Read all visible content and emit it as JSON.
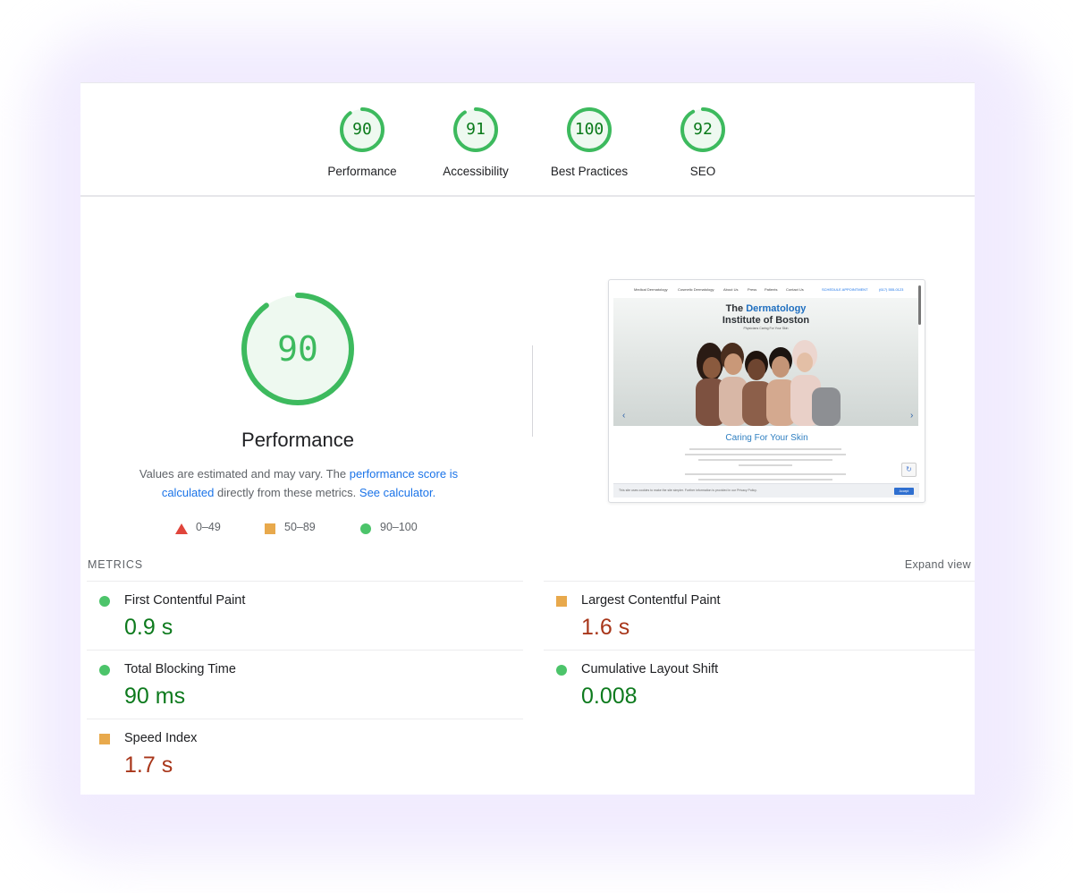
{
  "colors": {
    "pass": "#0d7a1d",
    "pass_ring": "#3dba5e",
    "average": "#a8361a",
    "average_icon": "#e8a94c",
    "fail_icon": "#e0453b",
    "link": "#1a73e8"
  },
  "category_gauges": [
    {
      "score": "90",
      "label": "Performance"
    },
    {
      "score": "91",
      "label": "Accessibility"
    },
    {
      "score": "100",
      "label": "Best Practices"
    },
    {
      "score": "92",
      "label": "SEO"
    }
  ],
  "performance": {
    "score": "90",
    "title": "Performance",
    "desc_prefix": "Values are estimated and may vary. The ",
    "desc_link1": "performance score is calculated",
    "desc_middle": " directly from these metrics. ",
    "desc_link2": "See calculator.",
    "legend": [
      {
        "icon": "triangle-icon",
        "range": "0–49"
      },
      {
        "icon": "square-icon",
        "range": "50–89"
      },
      {
        "icon": "circle-icon",
        "range": "90–100"
      }
    ]
  },
  "screenshot": {
    "nav": [
      "Medical Dermatology",
      "Cosmetic Dermatology",
      "About Us",
      "Press",
      "Patients",
      "Contact Us"
    ],
    "nav_cta": [
      "SCHEDULE APPOINTMENT",
      "(617) 555-0123"
    ],
    "hero_title_prefix": "The ",
    "hero_title_highlight": "Dermatology",
    "hero_title_line2": "Institute of Boston",
    "hero_tagline": "Physicians Caring For Your Skin",
    "section_heading": "Caring For Your Skin",
    "cookie_text": "This site uses cookies to make the site simpler. Further information is provided in our Privacy Policy.",
    "cookie_button": "Accept"
  },
  "metrics": {
    "header": "METRICS",
    "expand": "Expand view",
    "items": [
      {
        "label": "First Contentful Paint",
        "value": "0.9 s",
        "status": "pass",
        "icon": "circle-icon"
      },
      {
        "label": "Largest Contentful Paint",
        "value": "1.6 s",
        "status": "average",
        "icon": "square-icon"
      },
      {
        "label": "Total Blocking Time",
        "value": "90 ms",
        "status": "pass",
        "icon": "circle-icon"
      },
      {
        "label": "Cumulative Layout Shift",
        "value": "0.008",
        "status": "pass",
        "icon": "circle-icon"
      },
      {
        "label": "Speed Index",
        "value": "1.7 s",
        "status": "average",
        "icon": "square-icon"
      }
    ]
  }
}
